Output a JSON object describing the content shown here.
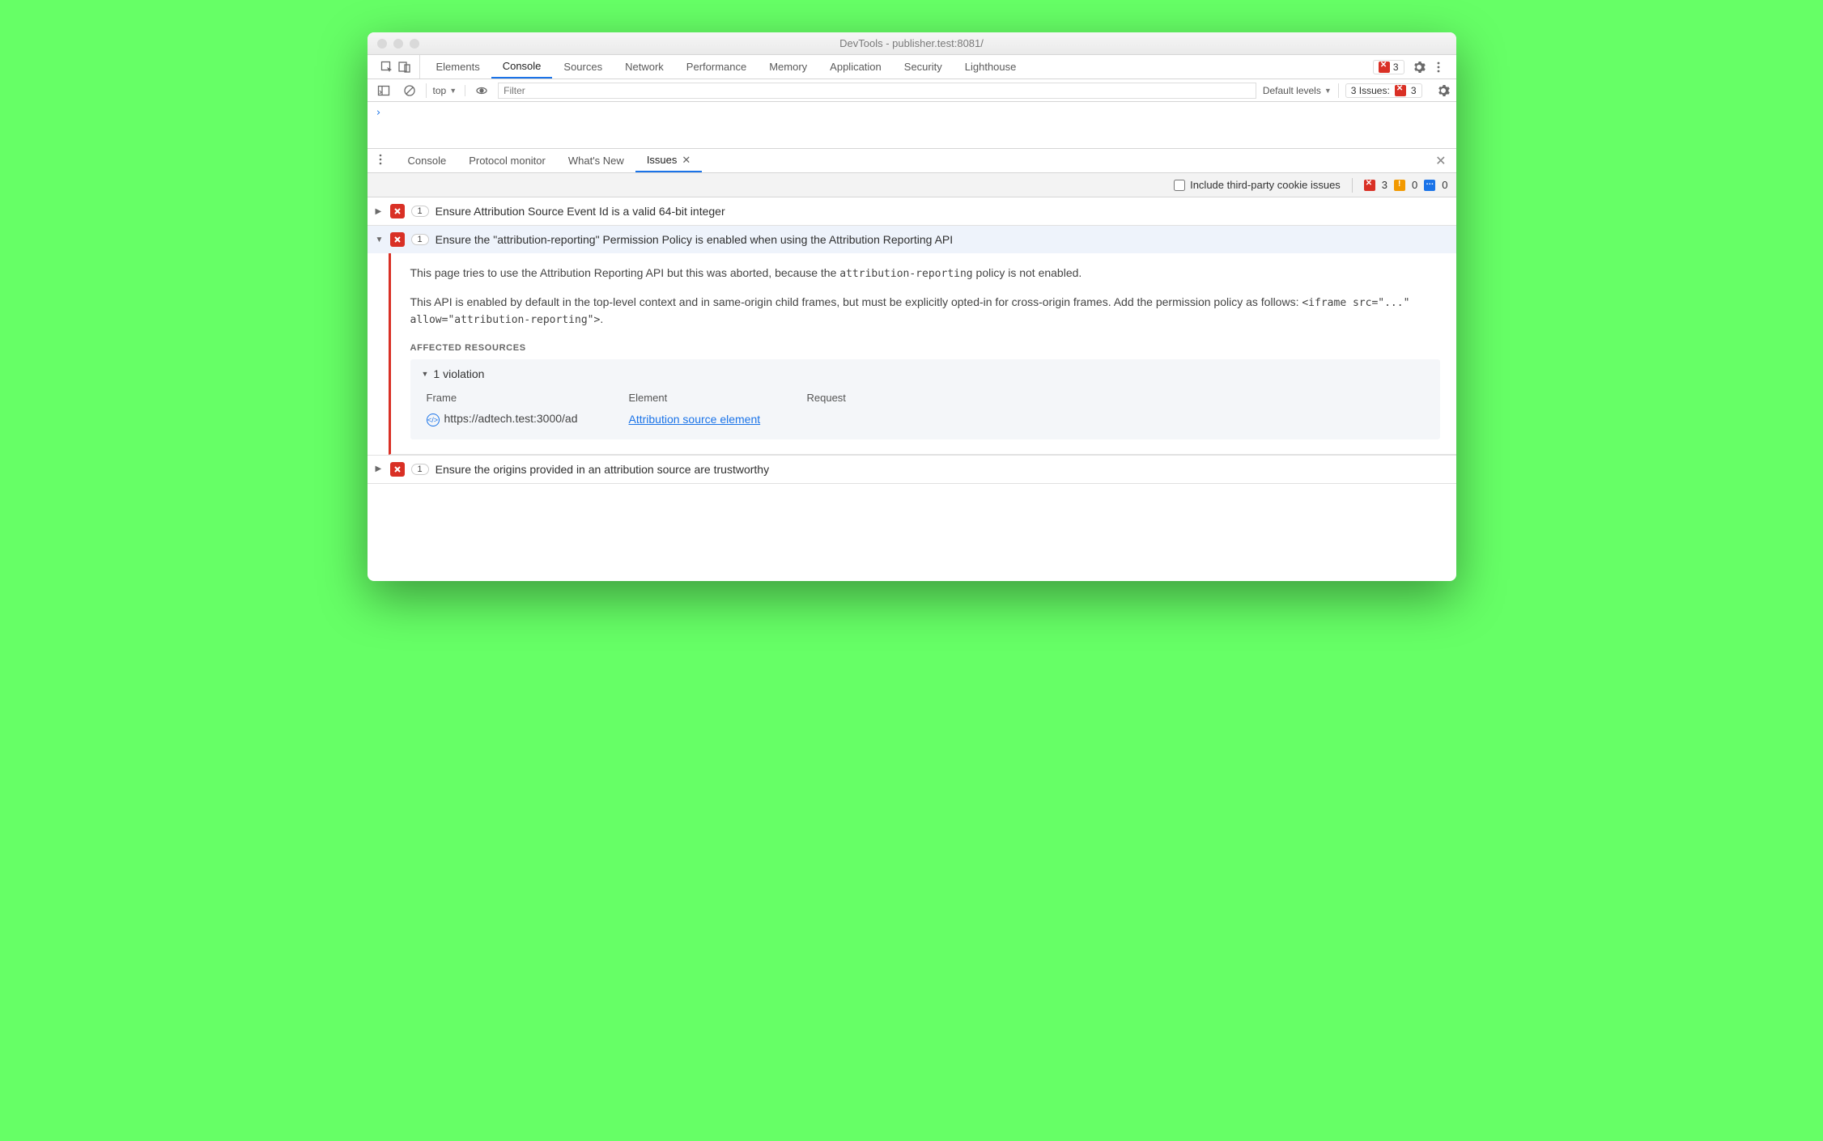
{
  "window": {
    "title": "DevTools - publisher.test:8081/"
  },
  "topTabs": {
    "items": [
      "Elements",
      "Console",
      "Sources",
      "Network",
      "Performance",
      "Memory",
      "Application",
      "Security",
      "Lighthouse"
    ],
    "activeIndex": 1,
    "errorCount": "3"
  },
  "consoleBar": {
    "context": "top",
    "filterPlaceholder": "Filter",
    "levels": "Default levels",
    "issuesLabel": "3 Issues:",
    "issuesCount": "3"
  },
  "consolePrompt": "›",
  "drawer": {
    "tabs": [
      "Console",
      "Protocol monitor",
      "What's New",
      "Issues"
    ],
    "activeIndex": 3
  },
  "issuesToolbar": {
    "includeThirdParty": "Include third-party cookie issues",
    "errors": "3",
    "warnings": "0",
    "info": "0"
  },
  "issues": [
    {
      "count": "1",
      "title": "Ensure Attribution Source Event Id is a valid 64-bit integer",
      "expanded": false
    },
    {
      "count": "1",
      "title": "Ensure the \"attribution-reporting\" Permission Policy is enabled when using the Attribution Reporting API",
      "expanded": true
    },
    {
      "count": "1",
      "title": "Ensure the origins provided in an attribution source are trustworthy",
      "expanded": false
    }
  ],
  "detail": {
    "p1a": "This page tries to use the Attribution Reporting API but this was aborted, because the ",
    "p1code": "attribution-reporting",
    "p1b": " policy is not enabled.",
    "p2a": "This API is enabled by default in the top-level context and in same-origin child frames, but must be explicitly opted-in for cross-origin frames. Add the permission policy as follows: ",
    "p2code": "<iframe src=\"...\" allow=\"attribution-reporting\">",
    "p2b": ".",
    "affectedHeading": "AFFECTED RESOURCES",
    "violation": "1 violation",
    "cols": {
      "frame": "Frame",
      "element": "Element",
      "request": "Request"
    },
    "row": {
      "frame": "https://adtech.test:3000/ad",
      "element": "Attribution source element"
    }
  }
}
